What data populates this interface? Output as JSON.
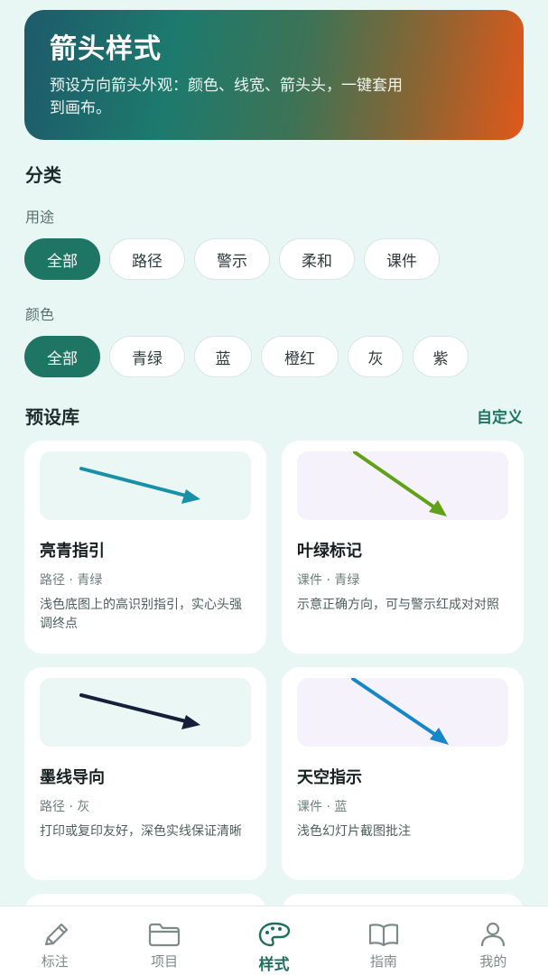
{
  "header": {
    "title": "箭头样式",
    "description": "预设方向箭头外观：颜色、线宽、箭头头，一键套用到画布。"
  },
  "category": {
    "title": "分类",
    "usage_label": "用途",
    "usage_chips": [
      "全部",
      "路径",
      "警示",
      "柔和",
      "课件"
    ],
    "color_label": "颜色",
    "color_chips": [
      "全部",
      "青绿",
      "蓝",
      "橙红",
      "灰",
      "紫"
    ]
  },
  "library": {
    "title": "预设库",
    "custom_link": "自定义",
    "presets": [
      {
        "name": "亮青指引",
        "tags": "路径 · 青绿",
        "desc": "浅色底图上的高识别指引，实心头强调终点",
        "color": "#1a8fa8",
        "bg": "#eaf7f4"
      },
      {
        "name": "叶绿标记",
        "tags": "课件 · 青绿",
        "desc": "示意正确方向，可与警示红成对对照",
        "color": "#5fa117",
        "bg": "#f6f2fb"
      },
      {
        "name": "墨线导向",
        "tags": "路径 · 灰",
        "desc": "打印或复印友好，深色实线保证清晰",
        "color": "#14203a",
        "bg": "#eaf7f4"
      },
      {
        "name": "天空指示",
        "tags": "课件 · 蓝",
        "desc": "浅色幻灯片截图批注",
        "color": "#1586c9",
        "bg": "#f6f2fb"
      }
    ]
  },
  "tabbar": {
    "items": [
      {
        "label": "标注",
        "icon": "pencil-icon"
      },
      {
        "label": "项目",
        "icon": "folder-icon"
      },
      {
        "label": "样式",
        "icon": "palette-icon"
      },
      {
        "label": "指南",
        "icon": "book-icon"
      },
      {
        "label": "我的",
        "icon": "user-icon"
      }
    ],
    "active_index": 2
  }
}
